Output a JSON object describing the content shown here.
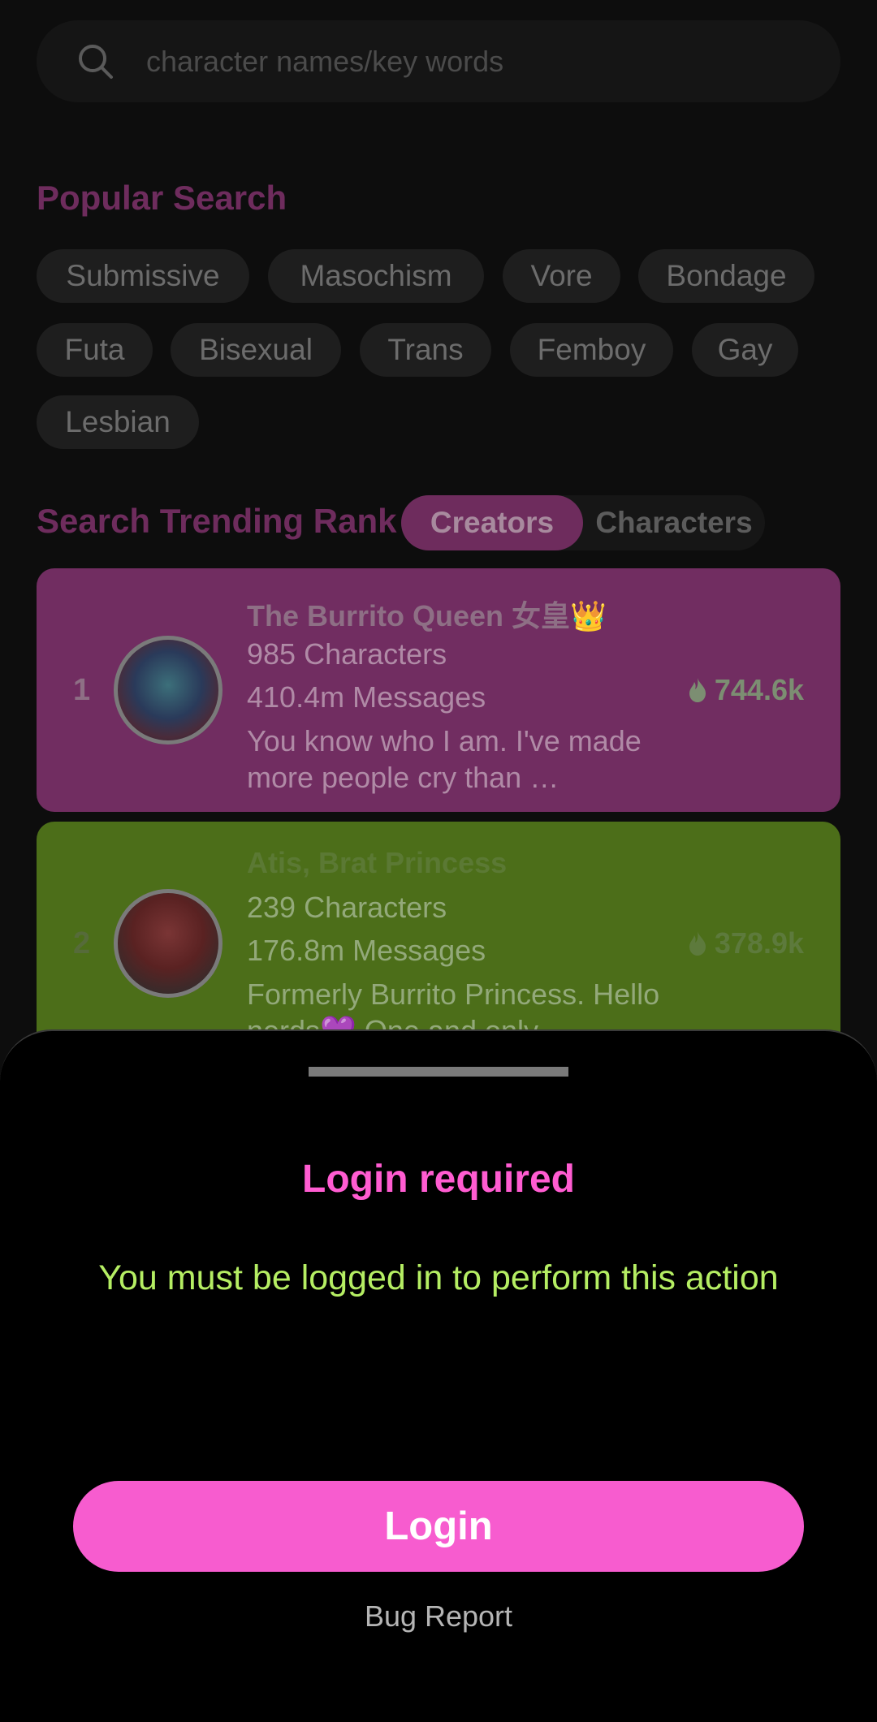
{
  "search": {
    "placeholder": "character names/key words",
    "icon": "search-icon"
  },
  "popular_search": {
    "title": "Popular Search",
    "tags": [
      "Submissive",
      "Masochism",
      "Vore",
      "Bondage",
      "Futa",
      "Bisexual",
      "Trans",
      "Femboy",
      "Gay",
      "Lesbian"
    ]
  },
  "trending": {
    "title": "Search Trending Rank",
    "tabs": [
      {
        "label": "Creators",
        "active": true
      },
      {
        "label": "Characters",
        "active": false
      }
    ],
    "creators": [
      {
        "rank": "1",
        "name": "The Burrito Queen 女皇👑",
        "characters": "985 Characters",
        "messages": "410.4m Messages",
        "description": "You know who I am. I've made more people cry than …",
        "score": "744.6k",
        "card_color": "#712d61"
      },
      {
        "rank": "2",
        "name": "Atis, Brat Princess",
        "characters": "239 Characters",
        "messages": "176.8m Messages",
        "description": "Formerly Burrito Princess. Hello nerds💜 One and only",
        "score": "378.9k",
        "card_color": "#4c6e19"
      }
    ]
  },
  "login_sheet": {
    "title": "Login required",
    "message": "You must be logged in to perform this action",
    "login_label": "Login",
    "bug_report_label": "Bug Report"
  },
  "colors": {
    "accent_pink": "#f75ccf",
    "title_pink": "#ff5cd1",
    "message_green": "#b5ee63",
    "background": "#0d0d0d"
  }
}
